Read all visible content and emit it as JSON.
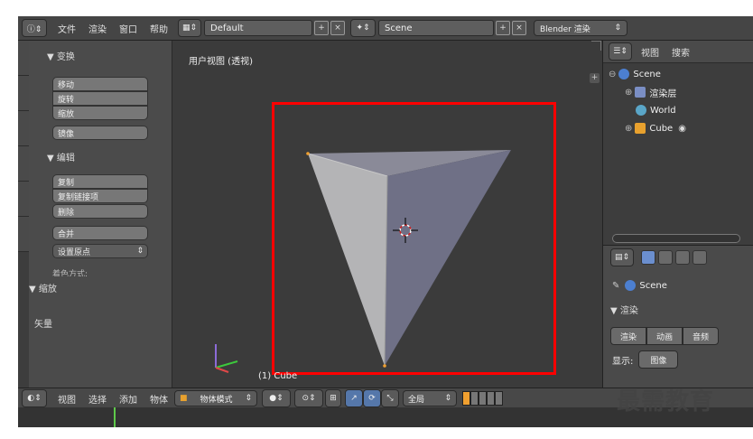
{
  "header": {
    "menus": [
      "文件",
      "渲染",
      "窗口",
      "帮助"
    ],
    "layout_name": "Default",
    "scene_name": "Scene",
    "render_engine": "Blender 渲染"
  },
  "toolshelf": {
    "transform_title": "▼ 变换",
    "transform_buttons": [
      "移动",
      "旋转",
      "缩放"
    ],
    "mirror_button": "镜像",
    "edit_title": "▼ 编辑",
    "edit_buttons": [
      "复制",
      "复制链接项"
    ],
    "delete_button": "删除",
    "join_button": "合并",
    "set_origin_button": "设置原点",
    "shading_label": "着色方式:",
    "scale_panel_title": "▼ 缩放",
    "vector_label": "矢量"
  },
  "viewport": {
    "title": "用户视图 (透视)",
    "object_label": "(1) Cube"
  },
  "outliner": {
    "header_items": [
      "视图",
      "搜索"
    ],
    "tree": [
      {
        "label": "Scene",
        "icon": "scene-icon"
      },
      {
        "label": "渲染层",
        "icon": "render-layers-icon"
      },
      {
        "label": "World",
        "icon": "world-icon"
      },
      {
        "label": "Cube",
        "icon": "cube-icon"
      }
    ]
  },
  "properties": {
    "scene_label": "Scene",
    "render_panel": "▼ 渲染",
    "render_buttons": [
      "渲染",
      "动画",
      "音频"
    ],
    "display_label": "显示:",
    "display_value": "图像"
  },
  "bottom_header": {
    "menus": [
      "视图",
      "选择",
      "添加",
      "物体"
    ],
    "mode": "物体模式",
    "orientation": "全局"
  },
  "watermark": "最需教育",
  "colors": {
    "highlight_box": "#ff0000",
    "timeline_marker": "#5ec94a",
    "ui_background": "#3a3a3a"
  }
}
